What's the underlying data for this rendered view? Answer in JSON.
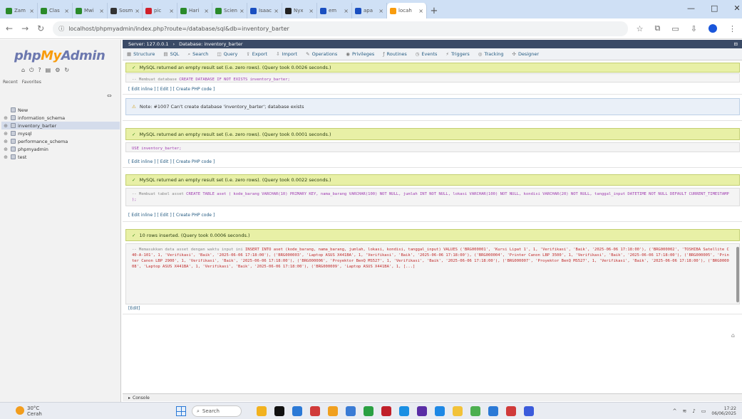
{
  "browser": {
    "tabs": [
      {
        "label": "Zam",
        "color": "#2a8a2a"
      },
      {
        "label": "Clas",
        "color": "#2a8a2a"
      },
      {
        "label": "Mwi",
        "color": "#2a8a2a"
      },
      {
        "label": "Sosm",
        "color": "#333333"
      },
      {
        "label": "pic",
        "color": "#d0202a"
      },
      {
        "label": "Hari",
        "color": "#2a8a2a"
      },
      {
        "label": "Scien",
        "color": "#2a8a2a"
      },
      {
        "label": "Isaac",
        "color": "#1a4fc0"
      },
      {
        "label": "Nyx",
        "color": "#222222"
      },
      {
        "label": "em",
        "color": "#1a4fc0"
      },
      {
        "label": "apa",
        "color": "#1a4fc0"
      },
      {
        "label": "locah",
        "color": "#f89c0e"
      }
    ],
    "active_tab_index": 11,
    "url": "localhost/phpmyadmin/index.php?route=/database/sql&db=inventory_barter"
  },
  "pma": {
    "logo": {
      "php": "php",
      "my": "My",
      "admin": "Admin"
    },
    "side_links": {
      "recent": "Recent",
      "favorites": "Favorites"
    },
    "tree": [
      {
        "label": "New",
        "selected": false
      },
      {
        "label": "information_schema",
        "selected": false
      },
      {
        "label": "inventory_barter",
        "selected": true
      },
      {
        "label": "mysql",
        "selected": false
      },
      {
        "label": "performance_schema",
        "selected": false
      },
      {
        "label": "phpmyadmin",
        "selected": false
      },
      {
        "label": "test",
        "selected": false
      }
    ],
    "breadcrumb": {
      "server": "Server: 127.0.0.1",
      "database": "Database: inventory_barter"
    },
    "menu": [
      {
        "label": "Structure",
        "icon": "table-icon"
      },
      {
        "label": "SQL",
        "icon": "sql-icon"
      },
      {
        "label": "Search",
        "icon": "search-icon"
      },
      {
        "label": "Query",
        "icon": "query-icon"
      },
      {
        "label": "Export",
        "icon": "export-icon"
      },
      {
        "label": "Import",
        "icon": "import-icon"
      },
      {
        "label": "Operations",
        "icon": "wrench-icon"
      },
      {
        "label": "Privileges",
        "icon": "privileges-icon"
      },
      {
        "label": "Routines",
        "icon": "routines-icon"
      },
      {
        "label": "Events",
        "icon": "events-icon"
      },
      {
        "label": "Triggers",
        "icon": "triggers-icon"
      },
      {
        "label": "Tracking",
        "icon": "tracking-icon"
      },
      {
        "label": "Designer",
        "icon": "designer-icon"
      }
    ],
    "results": {
      "r1_msg": "MySQL returned an empty result set (i.e. zero rows). (Query took 0.0026 seconds.)",
      "r1_sql_comment": "-- Membuat database",
      "r1_sql": "CREATE DATABASE IF NOT EXISTS inventory_barter;",
      "links": {
        "edit_inline": "Edit inline",
        "edit": "Edit",
        "create_php": "Create PHP code"
      },
      "note": "Note: #1007 Can't create database 'inventory_barter'; database exists",
      "r2_msg": "MySQL returned an empty result set (i.e. zero rows). (Query took 0.0001 seconds.)",
      "r2_sql": "USE inventory_barter;",
      "r3_msg": "MySQL returned an empty result set (i.e. zero rows). (Query took 0.0022 seconds.)",
      "r3_sql_comment": "-- Membuat tabel asset",
      "r3_sql": "CREATE TABLE aset ( kode_barang VARCHAR(10) PRIMARY KEY, nama_barang VARCHAR(100) NOT NULL, jumlah INT NOT NULL, lokasi VARCHAR(100) NOT NULL, kondisi VARCHAR(20) NOT NULL, tanggal_input DATETIME NOT NULL DEFAULT CURRENT_TIMESTAMP );",
      "r4_msg": "10 rows inserted. (Query took 0.0006 seconds.)",
      "r4_sql_comment": "-- Memasukkan data asset dengan waktu input ini",
      "r4_sql": "INSERT INTO aset (kode_barang, nama_barang, jumlah, lokasi, kondisi, tanggal_input) VALUES ('BRG000001', 'Kursi Lipat 1', 1, 'Verifikasi', 'Baik', '2025-06-06 17:18:00'), ('BRG000002', 'TOSHIBA Satellite C40-A-101', 1, 'Verifikasi', 'Baik', '2025-06-06 17:18:00'), ('BRG000003', 'Laptop ASUS X441BA', 1, 'Verifikasi', 'Baik', '2025-06-06 17:18:00'), ('BRG000004', 'Printer Canon LBP 3500', 1, 'Verifikasi', 'Baik', '2025-06-06 17:18:00'), ('BRG000005', 'Printer Canon LBP 2900', 1, 'Verifikasi', 'Baik', '2025-06-06 17:18:00'), ('BRG000006', 'Proyektor BenQ MS527', 1, 'Verifikasi', 'Baik', '2025-06-06 17:18:00'), ('BRG000007', 'Proyektor BenQ MS527', 1, 'Verifikasi', 'Baik', '2025-06-06 17:18:00'), ('BRG000008', 'Laptop ASUS X441BA', 1, 'Verifikasi', 'Baik', '2025-06-06 17:18:00'), ('BRG000009', 'Laptop ASUS X441BA', 1, [...]",
      "r4_edit": "[Edit]"
    },
    "console": "Console"
  },
  "taskbar": {
    "weather_temp": "30°C",
    "weather_desc": "Cerah",
    "search_placeholder": "Search",
    "time": "17:22",
    "date": "06/06/2025",
    "icon_colors": [
      "#f2b21f",
      "#111111",
      "#2b79d6",
      "#d03a3a",
      "#f0a020",
      "#3a7bd5",
      "#2aa043",
      "#c0202a",
      "#1a8fe3",
      "#5a2ea6",
      "#1e88e5",
      "#f2c23a",
      "#4caf50",
      "#2b79d6",
      "#d03a3a",
      "#3b5bdb"
    ]
  },
  "accent": {
    "pma_blue": "#6c78af",
    "pma_orange": "#f89c0e",
    "success_bg": "#e8f0a6"
  }
}
